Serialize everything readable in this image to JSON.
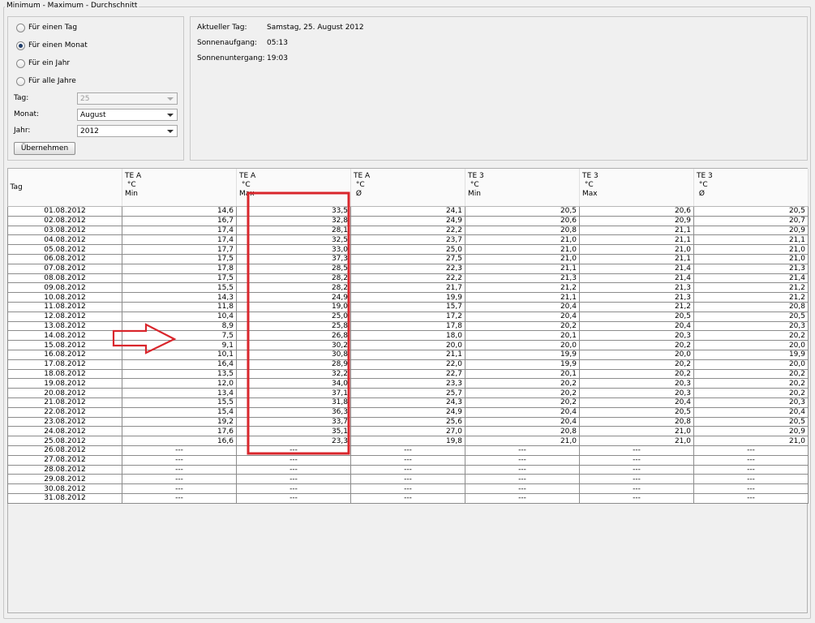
{
  "window": {
    "group_title": "Minimum - Maximum - Durchschnitt"
  },
  "selection": {
    "radios": [
      {
        "label": "Für einen Tag",
        "checked": false
      },
      {
        "label": "Für einen Monat",
        "checked": true
      },
      {
        "label": "Für ein Jahr",
        "checked": false
      },
      {
        "label": "Für alle Jahre",
        "checked": false
      }
    ],
    "tag_label": "Tag:",
    "tag_value": "25",
    "monat_label": "Monat:",
    "monat_value": "August",
    "jahr_label": "Jahr:",
    "jahr_value": "2012",
    "apply_label": "Übernehmen"
  },
  "info": {
    "current_day_label": "Aktueller Tag:",
    "current_day_value": "Samstag, 25. August 2012",
    "sunrise_label": "Sonnenaufgang:",
    "sunrise_value": "05:13",
    "sunset_label": "Sonnenuntergang:",
    "sunset_value": "19:03"
  },
  "table": {
    "columns": [
      "Tag",
      "TE A\n °C\nMin",
      "TE A\n °C\nMax",
      "TE A\n °C\n Ø",
      "TE 3\n °C\nMin",
      "TE 3\n °C\nMax",
      "TE 3\n °C\n Ø"
    ],
    "rows": [
      [
        "01.08.2012",
        "14,6",
        "33,5",
        "24,1",
        "20,5",
        "20,6",
        "20,5"
      ],
      [
        "02.08.2012",
        "16,7",
        "32,8",
        "24,9",
        "20,6",
        "20,9",
        "20,7"
      ],
      [
        "03.08.2012",
        "17,4",
        "28,1",
        "22,2",
        "20,8",
        "21,1",
        "20,9"
      ],
      [
        "04.08.2012",
        "17,4",
        "32,5",
        "23,7",
        "21,0",
        "21,1",
        "21,1"
      ],
      [
        "05.08.2012",
        "17,7",
        "33,0",
        "25,0",
        "21,0",
        "21,0",
        "21,0"
      ],
      [
        "06.08.2012",
        "17,5",
        "37,3",
        "27,5",
        "21,0",
        "21,1",
        "21,0"
      ],
      [
        "07.08.2012",
        "17,8",
        "28,5",
        "22,3",
        "21,1",
        "21,4",
        "21,3"
      ],
      [
        "08.08.2012",
        "17,5",
        "28,2",
        "22,2",
        "21,3",
        "21,4",
        "21,4"
      ],
      [
        "09.08.2012",
        "15,5",
        "28,2",
        "21,7",
        "21,2",
        "21,3",
        "21,2"
      ],
      [
        "10.08.2012",
        "14,3",
        "24,9",
        "19,9",
        "21,1",
        "21,3",
        "21,2"
      ],
      [
        "11.08.2012",
        "11,8",
        "19,0",
        "15,7",
        "20,4",
        "21,2",
        "20,8"
      ],
      [
        "12.08.2012",
        "10,4",
        "25,0",
        "17,2",
        "20,4",
        "20,5",
        "20,5"
      ],
      [
        "13.08.2012",
        "8,9",
        "25,8",
        "17,8",
        "20,2",
        "20,4",
        "20,3"
      ],
      [
        "14.08.2012",
        "7,5",
        "26,8",
        "18,0",
        "20,1",
        "20,3",
        "20,2"
      ],
      [
        "15.08.2012",
        "9,1",
        "30,2",
        "20,0",
        "20,0",
        "20,2",
        "20,0"
      ],
      [
        "16.08.2012",
        "10,1",
        "30,8",
        "21,1",
        "19,9",
        "20,0",
        "19,9"
      ],
      [
        "17.08.2012",
        "16,4",
        "28,9",
        "22,0",
        "19,9",
        "20,2",
        "20,0"
      ],
      [
        "18.08.2012",
        "13,5",
        "32,2",
        "22,7",
        "20,1",
        "20,2",
        "20,2"
      ],
      [
        "19.08.2012",
        "12,0",
        "34,0",
        "23,3",
        "20,2",
        "20,3",
        "20,2"
      ],
      [
        "20.08.2012",
        "13,4",
        "37,1",
        "25,7",
        "20,2",
        "20,3",
        "20,2"
      ],
      [
        "21.08.2012",
        "15,5",
        "31,8",
        "24,3",
        "20,2",
        "20,4",
        "20,3"
      ],
      [
        "22.08.2012",
        "15,4",
        "36,3",
        "24,9",
        "20,4",
        "20,5",
        "20,4"
      ],
      [
        "23.08.2012",
        "19,2",
        "33,7",
        "25,6",
        "20,4",
        "20,8",
        "20,5"
      ],
      [
        "24.08.2012",
        "17,6",
        "35,1",
        "27,0",
        "20,8",
        "21,0",
        "20,9"
      ],
      [
        "25.08.2012",
        "16,6",
        "23,3",
        "19,8",
        "21,0",
        "21,0",
        "21,0"
      ],
      [
        "26.08.2012",
        "---",
        "---",
        "---",
        "---",
        "---",
        "---"
      ],
      [
        "27.08.2012",
        "---",
        "---",
        "---",
        "---",
        "---",
        "---"
      ],
      [
        "28.08.2012",
        "---",
        "---",
        "---",
        "---",
        "---",
        "---"
      ],
      [
        "29.08.2012",
        "---",
        "---",
        "---",
        "---",
        "---",
        "---"
      ],
      [
        "30.08.2012",
        "---",
        "---",
        "---",
        "---",
        "---",
        "---"
      ],
      [
        "31.08.2012",
        "---",
        "---",
        "---",
        "---",
        "---",
        "---"
      ]
    ]
  },
  "annotation": {
    "color": "#d9262c"
  }
}
